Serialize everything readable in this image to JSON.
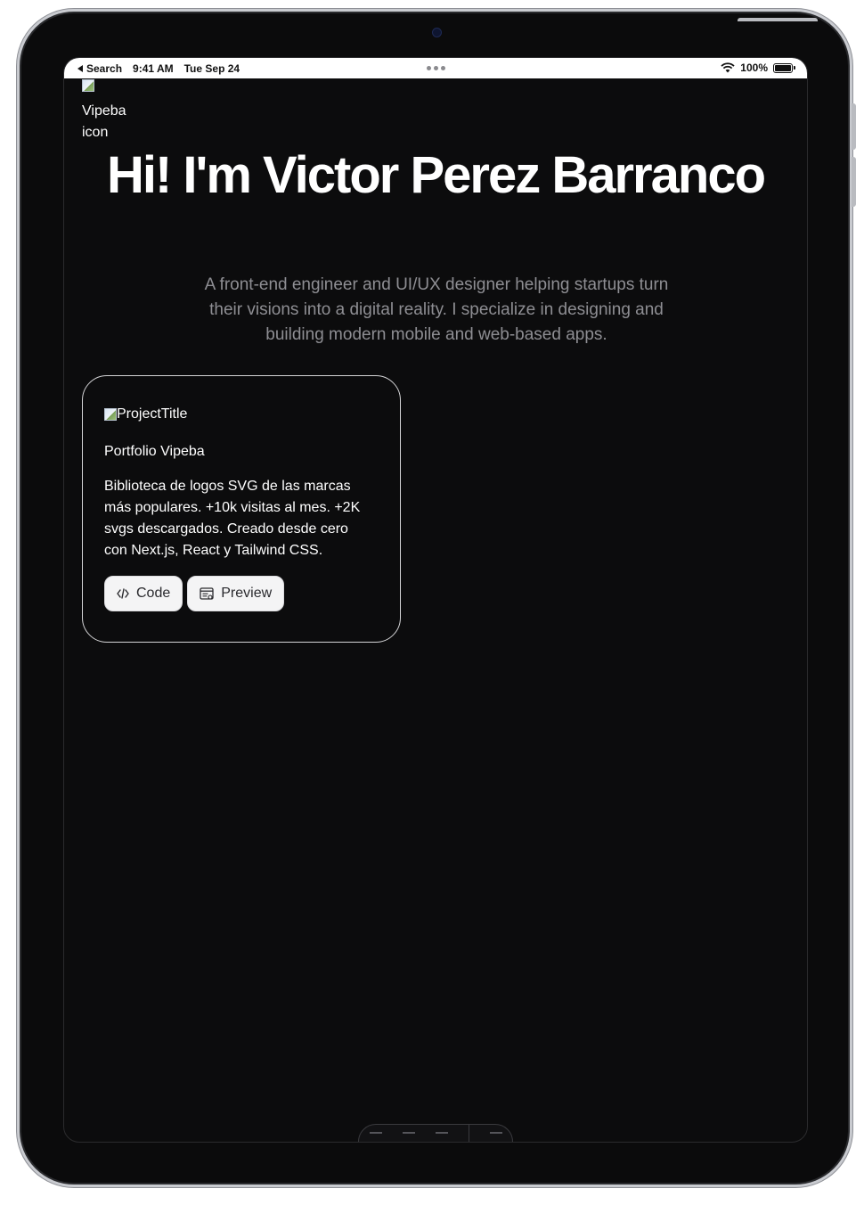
{
  "status_bar": {
    "back_label": "Search",
    "time": "9:41 AM",
    "date": "Tue Sep 24",
    "battery": "100%"
  },
  "header": {
    "logo_alt": "Vipeba icon"
  },
  "hero": {
    "title": "Hi! I'm Victor Perez Barranco",
    "subtitle": "A front-end engineer and UI/UX designer helping startups turn their visions into a digital reality. I specialize in designing and building modern mobile and web-based apps."
  },
  "project": {
    "image_alt": "ProjectTitle",
    "name": "Portfolio Vipeba",
    "description": "Biblioteca de logos SVG de las marcas más populares. +10k visitas al mes. +2K svgs descargados. Creado desde cero con Next.js, React y Tailwind CSS.",
    "code_label": "Code",
    "preview_label": "Preview"
  },
  "icons": {
    "code": "code-icon",
    "preview": "browser-preview-icon",
    "wifi": "wifi-icon",
    "battery": "battery-icon"
  }
}
